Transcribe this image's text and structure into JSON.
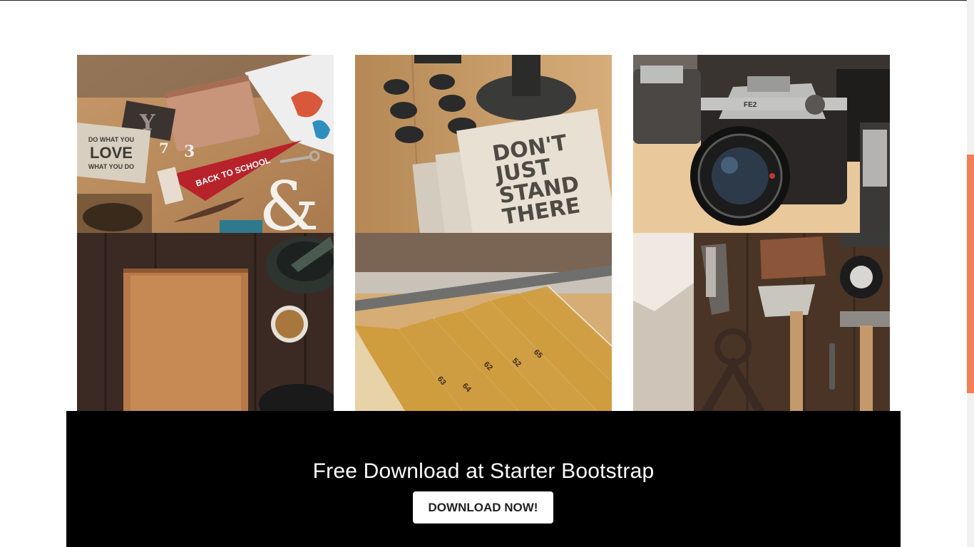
{
  "portfolio": {
    "items": [
      {
        "icon": "stationery-flatlay-image"
      },
      {
        "icon": "letterpress-cards-image"
      },
      {
        "icon": "vintage-cameras-image"
      },
      {
        "icon": "cutting-board-image"
      },
      {
        "icon": "folding-rulers-image"
      },
      {
        "icon": "workshop-tools-image"
      }
    ],
    "ruler_numbers": [
      "63",
      "64",
      "62",
      "52",
      "65"
    ]
  },
  "letterpress": {
    "line1": "DON'T",
    "line2": "JUST",
    "line3": "STAND",
    "line4": "THERE"
  },
  "pennant": {
    "text": "BACK TO SCHOOL"
  },
  "notebook": {
    "line1": "DO WHAT YOU",
    "line2": "LOVE",
    "line3": "WHAT YOU DO"
  },
  "cta": {
    "title": "Free Download at Starter Bootstrap",
    "button_label": "DOWNLOAD NOW!"
  },
  "colors": {
    "cta_background": "#000000",
    "scrollbar_thumb": "#f0805a"
  }
}
